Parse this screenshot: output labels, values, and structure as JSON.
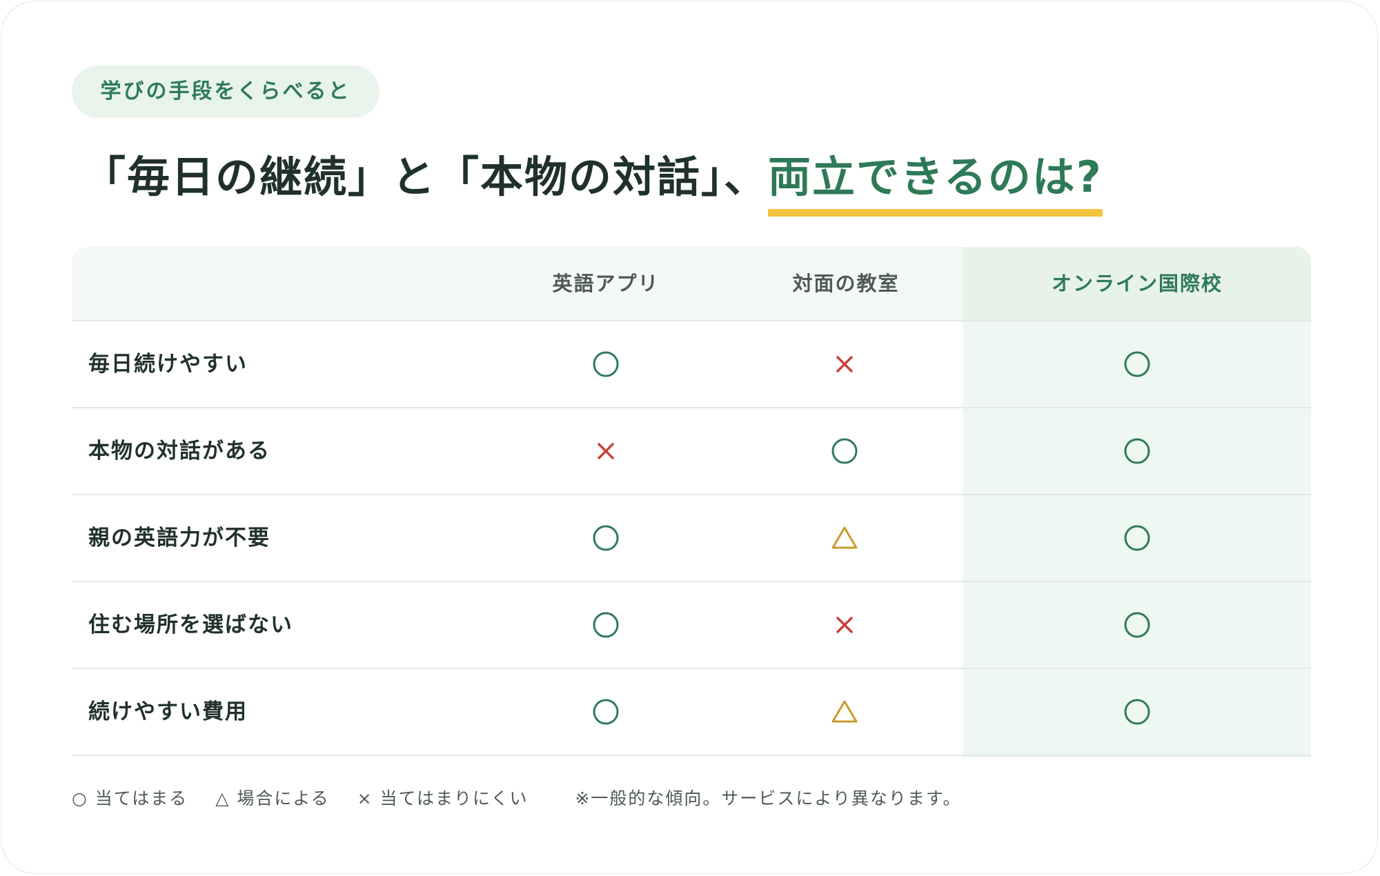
{
  "tag": "学びの手段をくらべると",
  "headline": {
    "part1": "「毎日の継続」と「本物の対話」、",
    "accent": "両立できるのは?"
  },
  "table": {
    "columns": [
      "英語アプリ",
      "対面の教室",
      "オンライン国際校"
    ],
    "rows": [
      {
        "label": "毎日続けやすい",
        "marks": [
          "circle",
          "cross",
          "circle"
        ]
      },
      {
        "label": "本物の対話がある",
        "marks": [
          "cross",
          "circle",
          "circle"
        ]
      },
      {
        "label": "親の英語力が不要",
        "marks": [
          "circle",
          "triangle",
          "circle"
        ]
      },
      {
        "label": "住む場所を選ばない",
        "marks": [
          "circle",
          "cross",
          "circle"
        ]
      },
      {
        "label": "続けやすい費用",
        "marks": [
          "circle",
          "triangle",
          "circle"
        ]
      }
    ]
  },
  "legend": {
    "circle": "○ 当てはまる",
    "triangle": "△ 場合による",
    "cross": "× 当てはまりにくい",
    "note": "※一般的な傾向。サービスにより異なります。"
  },
  "colors": {
    "circle": "#2e7a57",
    "cross": "#c9413a",
    "triangle": "#c99a2e",
    "accent_underline": "#f5c23d"
  }
}
